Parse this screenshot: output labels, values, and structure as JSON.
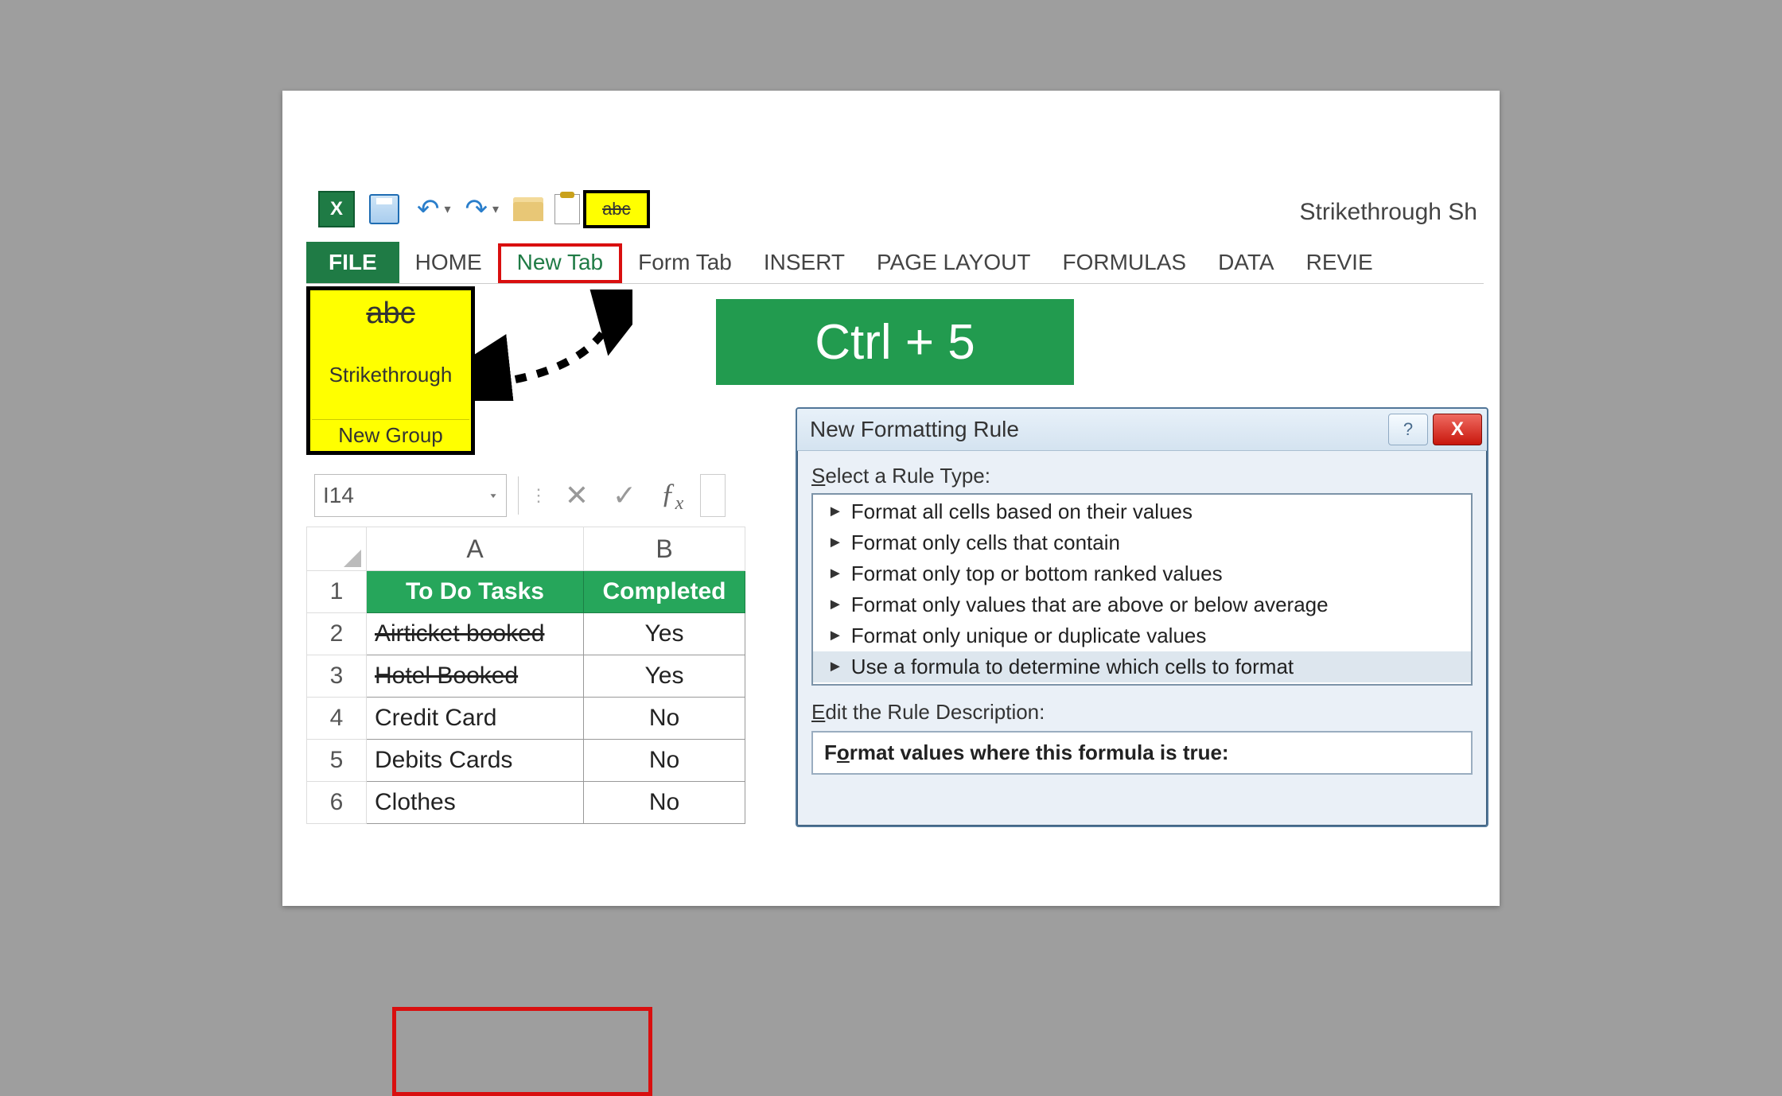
{
  "quick_access": {
    "abc_chip": "abc"
  },
  "document_title": "Strikethrough Sh",
  "tabs": {
    "file": "FILE",
    "home": "HOME",
    "newtab": "New Tab",
    "formtab": "Form Tab",
    "insert": "INSERT",
    "pagelayout": "PAGE LAYOUT",
    "formulas": "FORMULAS",
    "data": "DATA",
    "revie": "REVIE"
  },
  "ribbon_group": {
    "abc": "abc",
    "label1": "Strikethrough",
    "label2": "New Group"
  },
  "shortcut": "Ctrl + 5",
  "namebox": "I14",
  "fx": "fx",
  "columns": {
    "A": "A",
    "B": "B"
  },
  "rows": [
    "1",
    "2",
    "3",
    "4",
    "5",
    "6"
  ],
  "table": {
    "headers": {
      "A": "To Do Tasks",
      "B": "Completed"
    },
    "data": [
      {
        "A": "Airticket booked",
        "B": "Yes",
        "strike": true
      },
      {
        "A": "Hotel Booked",
        "B": "Yes",
        "strike": true
      },
      {
        "A": "Credit Card",
        "B": "No",
        "strike": false
      },
      {
        "A": "Debits Cards",
        "B": "No",
        "strike": false
      },
      {
        "A": "Clothes",
        "B": "No",
        "strike": false
      }
    ]
  },
  "dialog": {
    "title": "New Formatting Rule",
    "help": "?",
    "close": "X",
    "rule_type_label": "Select a Rule Type:",
    "rule_types": [
      "Format all cells based on their values",
      "Format only cells that contain",
      "Format only top or bottom ranked values",
      "Format only values that are above or below average",
      "Format only unique or duplicate values",
      "Use a formula to determine which cells to format"
    ],
    "selected_rule_index": 5,
    "desc_label": "Edit the Rule Description:",
    "desc_text": "Format values where this formula is true:"
  }
}
